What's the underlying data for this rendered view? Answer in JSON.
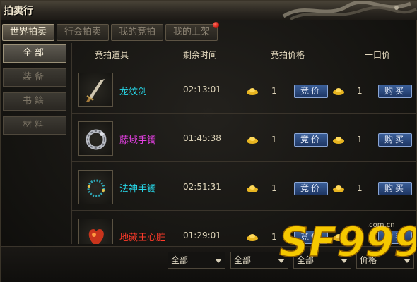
{
  "window": {
    "title": "拍卖行"
  },
  "tabs": [
    {
      "label": "世界拍卖",
      "active": true
    },
    {
      "label": "行会拍卖",
      "active": false
    },
    {
      "label": "我的竞拍",
      "active": false
    },
    {
      "label": "我的上架",
      "active": false,
      "badge": "red-dot"
    }
  ],
  "sidebar": {
    "items": [
      {
        "label": "全部",
        "active": true
      },
      {
        "label": "装备",
        "active": false
      },
      {
        "label": "书籍",
        "active": false
      },
      {
        "label": "材料",
        "active": false
      }
    ]
  },
  "table": {
    "headers": {
      "item": "竞拍道具",
      "time": "剩余时间",
      "bid_price": "竞拍价格",
      "buyout": "一口价"
    },
    "rows": [
      {
        "name": "龙纹剑",
        "name_color": "#27d7e8",
        "icon": "sword-icon",
        "time": "02:13:01",
        "bid_price": "1",
        "buyout_price": "1",
        "bid_label": "竞价",
        "buy_label": "购买"
      },
      {
        "name": "藤域手镯",
        "name_color": "#e23fe0",
        "icon": "bracelet-icon",
        "time": "01:45:38",
        "bid_price": "1",
        "buyout_price": "1",
        "bid_label": "竞价",
        "buy_label": "购买"
      },
      {
        "name": "法神手镯",
        "name_color": "#27d7e8",
        "icon": "bead-bracelet-icon",
        "time": "02:51:31",
        "bid_price": "1",
        "buyout_price": "1",
        "bid_label": "竞价",
        "buy_label": "购买"
      },
      {
        "name": "地藏王心脏",
        "name_color": "#ff3a2a",
        "icon": "heart-icon",
        "time": "01:29:01",
        "bid_price": "1",
        "buyout_price": "1",
        "bid_label": "竞价",
        "buy_label": "购买"
      }
    ],
    "currency_icon": "gold-ingot-icon"
  },
  "footer": {
    "filters": [
      {
        "value": "全部"
      },
      {
        "value": "全部"
      },
      {
        "value": "全部"
      },
      {
        "value": "价格"
      }
    ]
  },
  "watermark": {
    "brand": "SF999",
    "suffix": ".com.cn"
  }
}
